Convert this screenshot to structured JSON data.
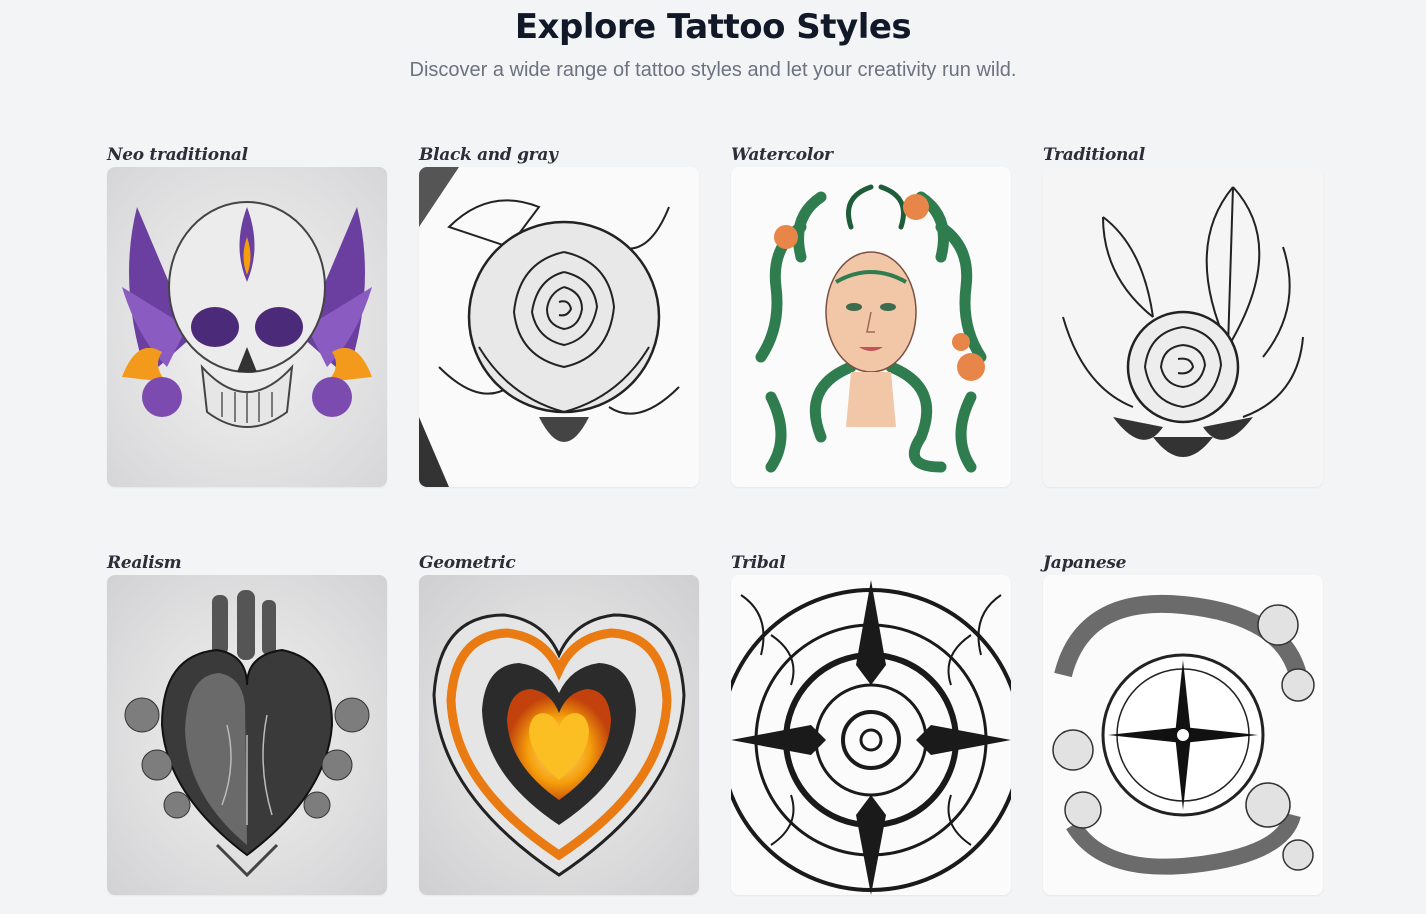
{
  "header": {
    "title": "Explore Tattoo Styles",
    "subtitle": "Discover a wide range of tattoo styles and let your creativity run wild."
  },
  "styles": [
    {
      "label": "Neo traditional",
      "icon": "skull-tattoo-image"
    },
    {
      "label": "Black and gray",
      "icon": "rose-tattoo-image"
    },
    {
      "label": "Watercolor",
      "icon": "medusa-tattoo-image"
    },
    {
      "label": "Traditional",
      "icon": "feather-rose-tattoo-image"
    },
    {
      "label": "Realism",
      "icon": "anatomical-heart-tattoo-image"
    },
    {
      "label": "Geometric",
      "icon": "ornate-heart-tattoo-image"
    },
    {
      "label": "Tribal",
      "icon": "tribal-mandala-tattoo-image"
    },
    {
      "label": "Japanese",
      "icon": "compass-dragon-tattoo-image"
    }
  ],
  "colors": {
    "background": "#f3f4f6",
    "title": "#111827",
    "subtitle": "#6b7280",
    "label": "#2d2d3a"
  }
}
